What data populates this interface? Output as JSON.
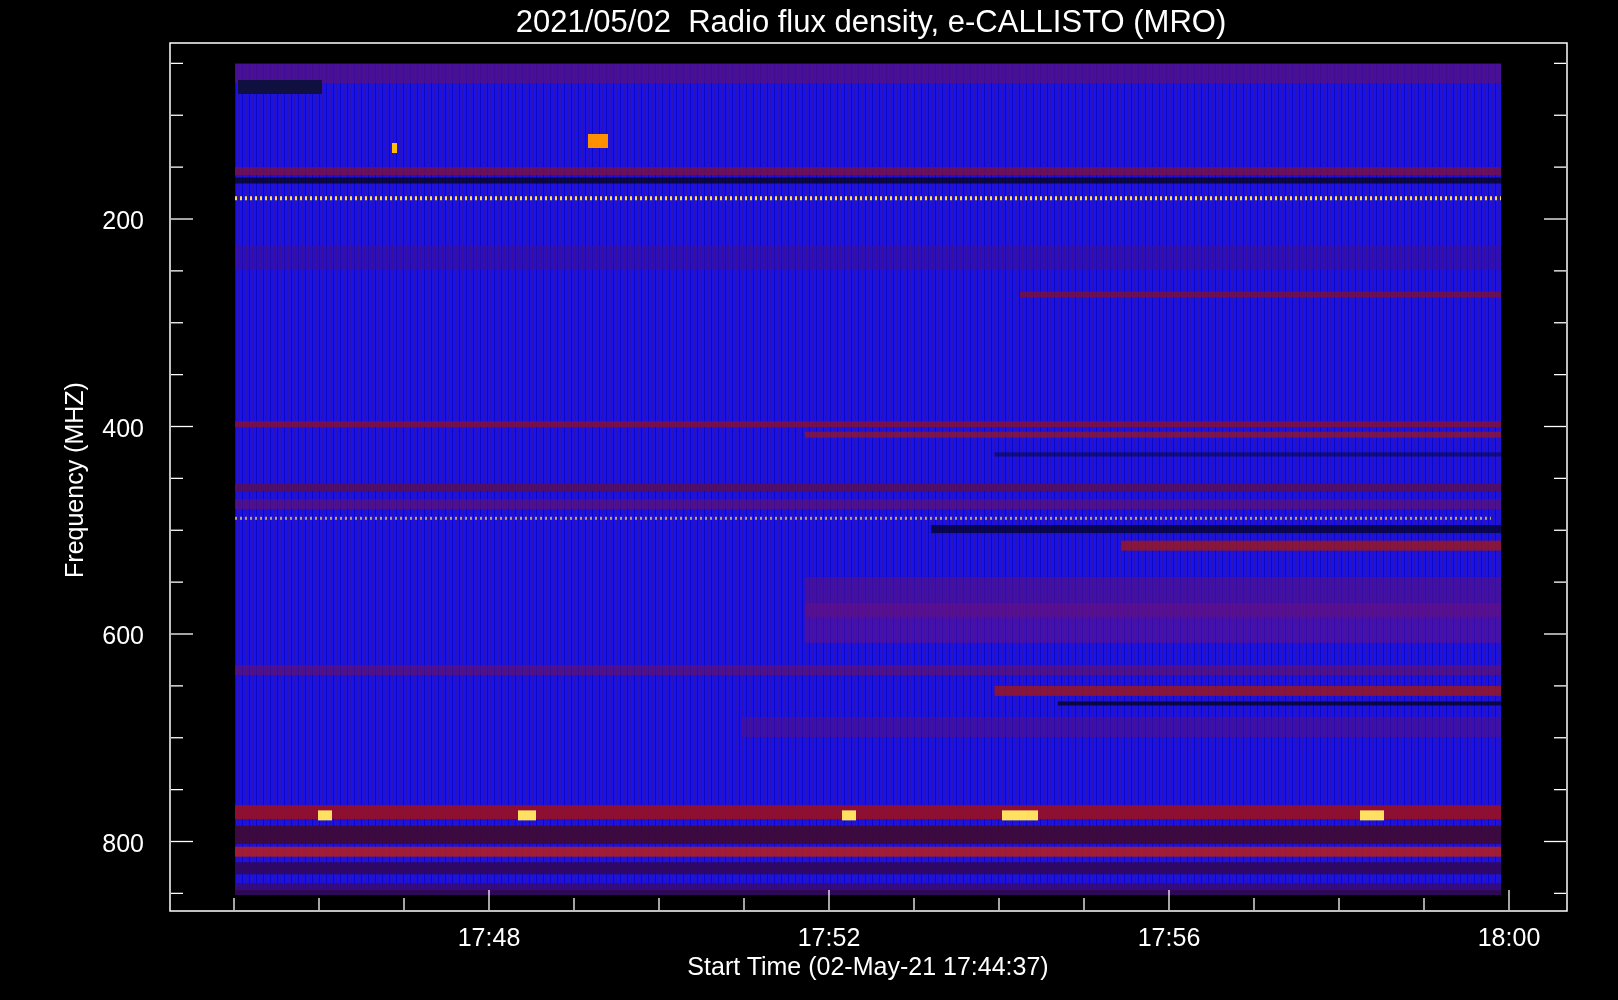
{
  "title": "2021/05/02  Radio flux density, e-CALLISTO (MRO)",
  "y_axis": {
    "label": "Frequency (MHZ)",
    "ticks": [
      "200",
      "400",
      "600",
      "800"
    ]
  },
  "x_axis": {
    "label": "Start Time (02-May-21 17:44:37)",
    "ticks": [
      "17:48",
      "17:52",
      "17:56",
      "18:00"
    ]
  }
}
